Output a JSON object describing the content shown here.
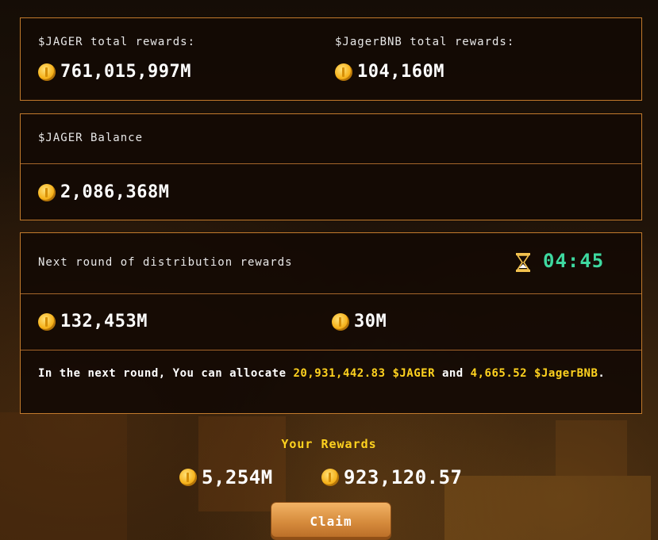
{
  "rewards_summary": {
    "jager_total_label": "$JAGER total rewards:",
    "jager_total_value": "761,015,997M",
    "jagerbnb_total_label": "$JagerBNB total rewards:",
    "jagerbnb_total_value": "104,160M"
  },
  "balance": {
    "label": "$JAGER Balance",
    "value": "2,086,368M"
  },
  "next_round": {
    "label": "Next round of distribution rewards",
    "timer": "04:45",
    "jager_value": "132,453M",
    "jagerbnb_value": "30M",
    "allocation": {
      "prefix": "In the next round, You can allocate ",
      "jager_amount": "20,931,442.83 $JAGER",
      "middle": " and ",
      "jagerbnb_amount": "4,665.52 $JagerBNB",
      "suffix": "."
    }
  },
  "your_rewards": {
    "title": "Your Rewards",
    "jager_value": "5,254M",
    "jagerbnb_value": "923,120.57"
  },
  "claim_button": {
    "label": "Claim"
  },
  "icons": {
    "coin": "coin-icon",
    "timer": "hourglass-icon"
  },
  "colors": {
    "panel_border": "#c27a2c",
    "timer": "#3ed9a0",
    "highlight": "#ffd21f",
    "coin": "#f6b21b"
  }
}
